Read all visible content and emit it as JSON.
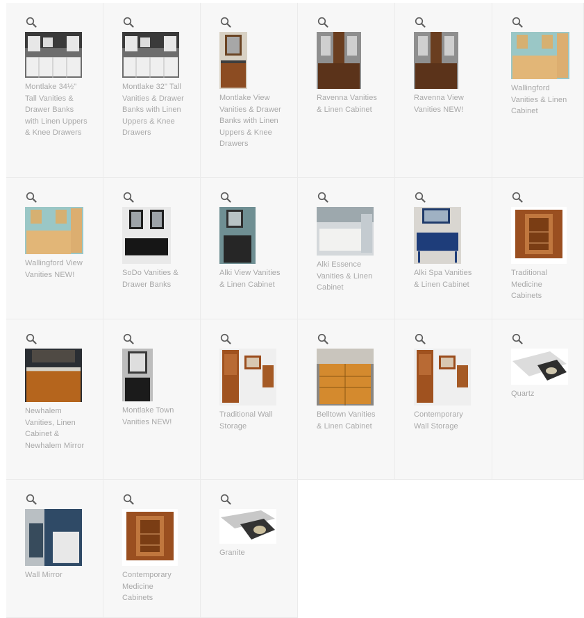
{
  "rows": [
    [
      {
        "label": "Montlake 34½\" Tall Vanities & Drawer Banks with Linen Uppers & Knee Drawers",
        "thumb": "white-vanity",
        "icon": "search-icon"
      },
      {
        "label": "Montlake 32\" Tall Vanities & Drawer Banks with Linen Uppers & Knee Drawers",
        "thumb": "white-vanity",
        "icon": "search-icon"
      },
      {
        "label": "Montlake View Vanities & Drawer Banks with Linen Uppers & Knee Drawers",
        "thumb": "wood-vanity-small",
        "icon": "search-icon"
      },
      {
        "label": "Ravenna Vanities & Linen Cabinet",
        "thumb": "ravenna",
        "icon": "search-icon"
      },
      {
        "label": "Ravenna View Vanities NEW!",
        "thumb": "ravenna",
        "icon": "search-icon"
      },
      {
        "label": "Wallingford Vanities & Linen Cabinet",
        "thumb": "wallingford",
        "icon": "search-icon"
      }
    ],
    [
      {
        "label": "Wallingford View Vanities NEW!",
        "thumb": "wallingford",
        "icon": "search-icon"
      },
      {
        "label": "SoDo Vanities & Drawer Banks",
        "thumb": "sodo",
        "icon": "search-icon"
      },
      {
        "label": "Alki View Vanities & Linen Cabinet",
        "thumb": "alki-view",
        "icon": "search-icon"
      },
      {
        "label": "Alki Essence Vanities & Linen Cabinet",
        "thumb": "alki-essence",
        "icon": "search-icon"
      },
      {
        "label": "Alki Spa Vanities & Linen Cabinet",
        "thumb": "alki-spa",
        "icon": "search-icon"
      },
      {
        "label": "Traditional Medicine Cabinets",
        "thumb": "medicine",
        "icon": "search-icon"
      }
    ],
    [
      {
        "label": "Newhalem Vanities, Linen Cabinet & Newhalem Mirror",
        "thumb": "newhalem",
        "icon": "search-icon"
      },
      {
        "label": "Montlake Town Vanities NEW!",
        "thumb": "town",
        "icon": "search-icon"
      },
      {
        "label": "Traditional Wall Storage",
        "thumb": "wall-storage",
        "icon": "search-icon"
      },
      {
        "label": "Belltown Vanities & Linen Cabinet",
        "thumb": "belltown",
        "icon": "search-icon"
      },
      {
        "label": "Contemporary Wall Storage",
        "thumb": "wall-storage",
        "icon": "search-icon"
      },
      {
        "label": "Quartz",
        "thumb": "quartz",
        "icon": "search-icon"
      }
    ],
    [
      {
        "label": "Wall Mirror",
        "thumb": "mirror",
        "icon": "search-icon"
      },
      {
        "label": "Contemporary Medicine Cabinets",
        "thumb": "medicine",
        "icon": "search-icon"
      },
      {
        "label": "Granite",
        "thumb": "granite",
        "icon": "search-icon"
      }
    ]
  ]
}
